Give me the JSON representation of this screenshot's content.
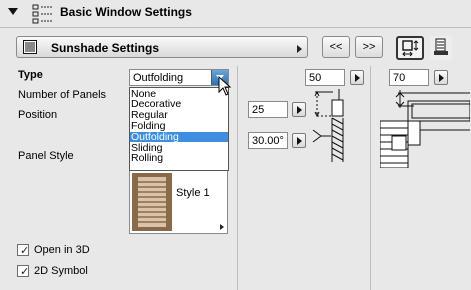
{
  "header": {
    "title": "Basic Window Settings",
    "collapse_icon": "triangle-down-icon",
    "section_icon": "window-settings-icon"
  },
  "settings_bar": {
    "label": "Sunshade Settings",
    "icon": "sunshade-panel-icon"
  },
  "nav": {
    "prev_label": "<<",
    "next_label": ">>"
  },
  "tools": {
    "selected": "dimension-toggle-icon",
    "other": "sunshade-3d-icon"
  },
  "form": {
    "type_label": "Type",
    "type_value": "Outfolding",
    "number_of_panels_label": "Number of Panels",
    "position_label": "Position",
    "panel_style_label": "Panel Style",
    "panel_style_value": "Style 1",
    "type_options": [
      "None",
      "Decorative",
      "Regular",
      "Folding",
      "Outfolding",
      "Sliding",
      "Rolling"
    ],
    "type_selected_index": 4
  },
  "inputs": {
    "width_value": "50",
    "depth_value": "70",
    "offset_value": "25",
    "angle_value": "30.00°"
  },
  "checkboxes": {
    "open_in_3d": {
      "label": "Open in 3D",
      "checked": true
    },
    "symbol_2d": {
      "label": "2D Symbol",
      "checked": true
    }
  },
  "colors": {
    "selection": "#3d8ee0",
    "panel_wood": "#8b6a4a"
  }
}
